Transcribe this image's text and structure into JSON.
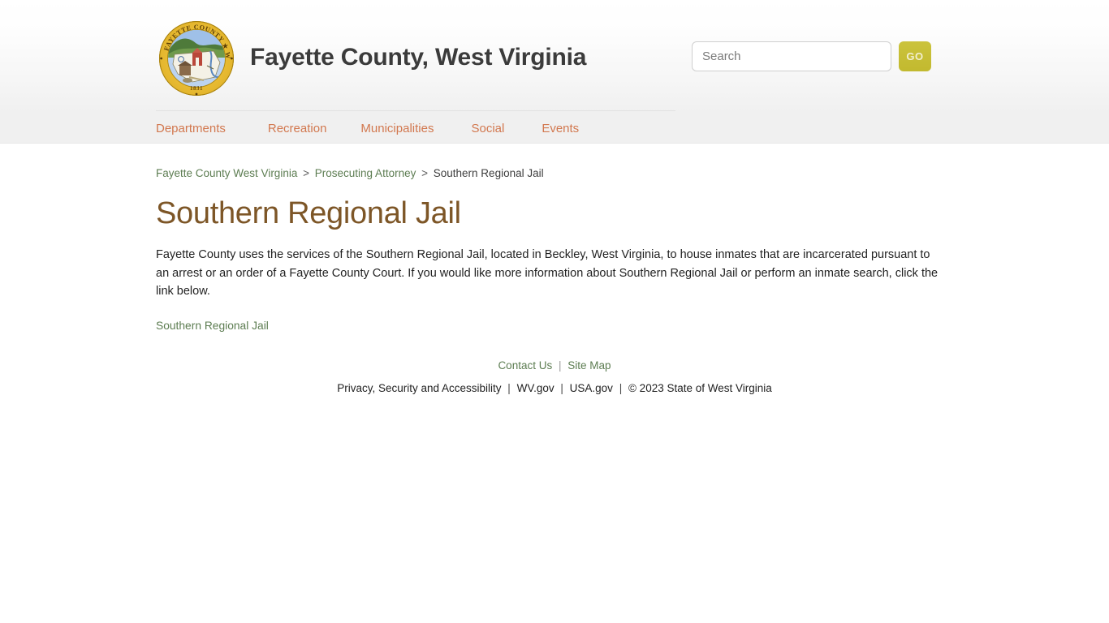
{
  "header": {
    "site_title": "Fayette County, West Virginia",
    "seal": {
      "icon": "county-seal-icon",
      "ring_text_left": "FAYETTE COUNTY",
      "ring_text_right": "WEST VIRGINIA",
      "year": "1831",
      "ring_color": "#e8bb33"
    },
    "search": {
      "placeholder": "Search",
      "value": "",
      "button_label": "GO",
      "button_color": "#c2b92f"
    }
  },
  "nav": {
    "items": [
      {
        "label": "Departments"
      },
      {
        "label": "Recreation"
      },
      {
        "label": "Municipalities"
      },
      {
        "label": "Social"
      },
      {
        "label": "Events"
      }
    ],
    "link_color": "#d2784f"
  },
  "breadcrumb": {
    "items": [
      {
        "label": "Fayette County West Virginia",
        "is_link": true
      },
      {
        "label": "Prosecuting Attorney",
        "is_link": true
      },
      {
        "label": "Southern Regional Jail",
        "is_link": false
      }
    ],
    "separator": ">"
  },
  "main": {
    "page_title": "Southern Regional Jail",
    "title_color": "#7d5627",
    "paragraph": "Fayette County uses the services of the Southern Regional Jail, located in Beckley, West Virginia, to house inmates that are incarcerated pursuant to an arrest or an order of a Fayette County Court. If you would like more information about Southern Regional Jail or perform an inmate search, click the link below.",
    "link_label": "Southern Regional Jail",
    "link_color": "#5d7d52"
  },
  "footer": {
    "primary_links": [
      {
        "label": "Contact Us"
      },
      {
        "label": "Site Map"
      }
    ],
    "separator": "|",
    "legal_links": [
      {
        "label": "Privacy, Security and Accessibility"
      },
      {
        "label": "WV.gov"
      },
      {
        "label": "USA.gov"
      }
    ],
    "copyright": "© 2023 State of West Virginia"
  }
}
